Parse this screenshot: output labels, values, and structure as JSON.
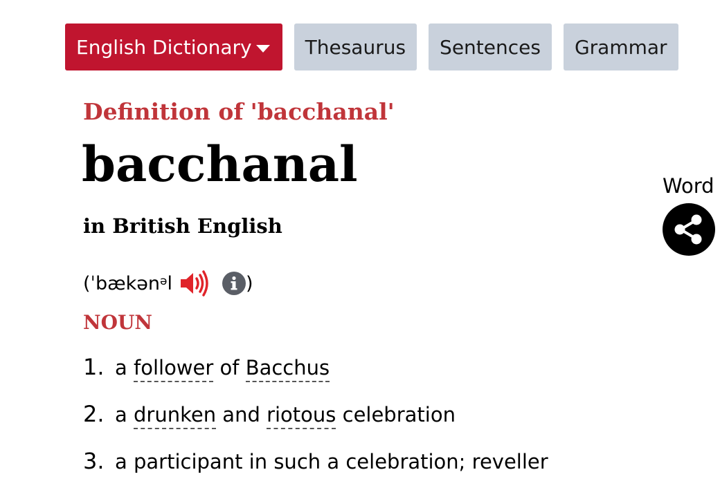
{
  "tabs": [
    {
      "label": "English Dictionary",
      "active": true
    },
    {
      "label": "Thesaurus",
      "active": false
    },
    {
      "label": "Sentences",
      "active": false
    },
    {
      "label": "Grammar",
      "active": false
    }
  ],
  "entry": {
    "definition_prefix": "Definition of",
    "definition_word": "'bacchanal'",
    "headword": "bacchanal",
    "variety": "in British English",
    "pron_open": "(ˈbækən",
    "pron_sup": "ə",
    "pron_tail": "l",
    "pron_close": ")",
    "part_of_speech": "NOUN",
    "senses": [
      {
        "number": "1.",
        "parts": [
          {
            "text": "a ",
            "link": false
          },
          {
            "text": "follower",
            "link": true
          },
          {
            "text": " of ",
            "link": false
          },
          {
            "text": "Bacchus",
            "link": true
          }
        ]
      },
      {
        "number": "2.",
        "parts": [
          {
            "text": "a ",
            "link": false
          },
          {
            "text": "drunken",
            "link": true
          },
          {
            "text": " and ",
            "link": false
          },
          {
            "text": "riotous",
            "link": true
          },
          {
            "text": " celebration",
            "link": false
          }
        ]
      },
      {
        "number": "3.",
        "parts": [
          {
            "text": "a participant in such a celebration; reveller",
            "link": false
          }
        ]
      }
    ]
  },
  "share": {
    "label": "Word",
    "icon": "share-icon"
  },
  "colors": {
    "brand_red": "#c0152f",
    "heading_red": "#c0353a",
    "tab_gray": "#c9d1dc",
    "speaker_red": "#e0242a",
    "info_gray": "#5a5e66"
  }
}
